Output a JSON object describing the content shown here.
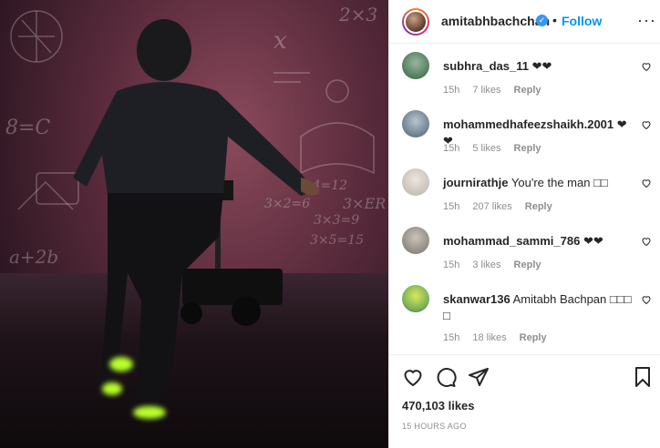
{
  "post": {
    "author": "amitabhbachchan",
    "follow_label": "Follow",
    "separator": "•",
    "more_label": "···",
    "media_alt_icon": "photo"
  },
  "comments": [
    {
      "username": "subhra_das_11",
      "text": "❤❤",
      "time": "15h",
      "likes": "7 likes",
      "reply": "Reply",
      "avatar_color": "#4f7a5a"
    },
    {
      "username": "mohammedhafeezshaikh.2001",
      "text": "❤❤",
      "time": "15h",
      "likes": "5 likes",
      "reply": "Reply",
      "avatar_color": "#6b7d8f"
    },
    {
      "username": "journirathje",
      "text": "You're the man □□",
      "time": "15h",
      "likes": "207 likes",
      "reply": "Reply",
      "avatar_color": "#c8c1b8"
    },
    {
      "username": "mohammad_sammi_786",
      "text": "❤❤",
      "time": "15h",
      "likes": "3 likes",
      "reply": "Reply",
      "avatar_color": "#8f8a80"
    },
    {
      "username": "skanwar136",
      "text": "Amitabh Bachpan □□□ □",
      "time": "15h",
      "likes": "18 likes",
      "reply": "Reply",
      "avatar_color": "#7fb35a"
    }
  ],
  "footer": {
    "likes_count": "470,103 likes",
    "timestamp": "15 HOURS AGO"
  },
  "chalkboard": [
    "2×3",
    "8=C",
    "3×4=12",
    "3×2=6",
    "3×3=9",
    "3×5=15",
    "a+2b",
    "x",
    "3×ER"
  ]
}
